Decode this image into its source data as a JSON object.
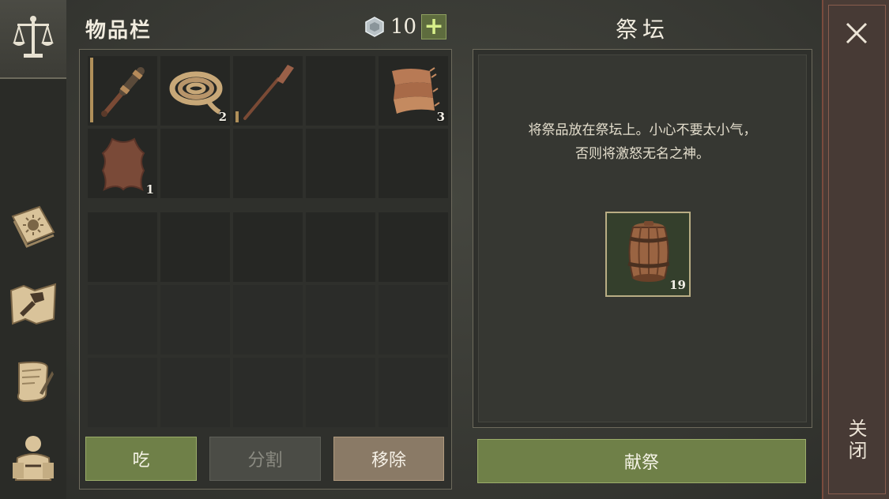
{
  "inventory": {
    "title": "物品栏",
    "currency": {
      "value": "10",
      "add_label": "+",
      "icon": "gem-icon"
    },
    "slots_row1": [
      {
        "item": "spyglass-icon",
        "qty": ""
      },
      {
        "item": "rope-icon",
        "qty": "2"
      },
      {
        "item": "oar-icon",
        "qty": ""
      },
      {
        "item": "",
        "qty": ""
      },
      {
        "item": "cloth-icon",
        "qty": "3"
      }
    ],
    "slots_row2": [
      {
        "item": "leather-icon",
        "qty": "1"
      }
    ],
    "buttons": {
      "eat": "吃",
      "split": "分割",
      "remove": "移除"
    }
  },
  "altar": {
    "title": "祭坛",
    "description_line1": "将祭品放在祭坛上。小心不要太小气，",
    "description_line2": "否则将激怒无名之神。",
    "offering": {
      "item": "barrel-icon",
      "qty": "19"
    },
    "offer_label": "献祭"
  },
  "close": {
    "label": "关闭"
  },
  "sidebar": {
    "items": [
      "scales-icon",
      "journal-icon",
      "crafting-map-icon",
      "quest-scroll-icon",
      "character-icon"
    ]
  },
  "colors": {
    "accent_green": "#6f8048",
    "close_red": "#7a4b3d"
  }
}
